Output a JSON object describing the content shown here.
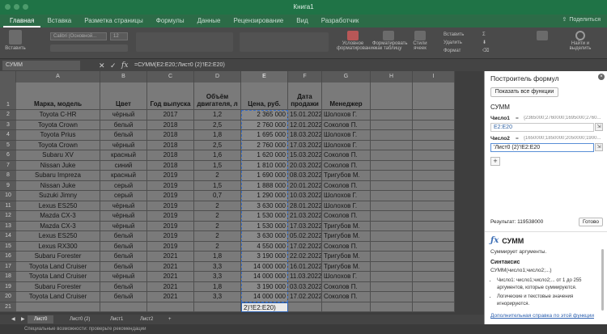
{
  "window": {
    "title": "Книга1"
  },
  "ribbon_tabs": [
    "Главная",
    "Вставка",
    "Разметка страницы",
    "Формулы",
    "Данные",
    "Рецензирование",
    "Вид",
    "Разработчик"
  ],
  "share_label": "Поделиться",
  "ribbon": {
    "paste_label": "Вставить",
    "font_name": "Calibri (Основной...",
    "font_size": "12",
    "cond_format": "Условное форматирование",
    "as_table": "Форматировать как таблицу",
    "cell_styles": "Стили ячеек",
    "insert": "Вставить",
    "delete": "Удалить",
    "format": "Формат",
    "find": "Найти и выделить"
  },
  "formula_bar": {
    "name_box": "СУММ",
    "cancel": "✕",
    "enter": "✓",
    "fx": "fx",
    "formula": "=СУММ(E2:E20;'Лист0 (2)'!E2:E20)"
  },
  "columns": [
    "A",
    "B",
    "C",
    "D",
    "E",
    "F",
    "G",
    "H",
    "I"
  ],
  "headers": {
    "a": "Марка, модель",
    "b": "Цвет",
    "c": "Год выпуска",
    "d": "Объём двигателя, л",
    "e": "Цена, руб.",
    "f": "Дата продажи",
    "g": "Менеджер"
  },
  "rows": [
    [
      "Toyota C-HR",
      "чёрный",
      "2017",
      "1,2",
      "2 365 000",
      "15.01.2022",
      "Шолохов Г."
    ],
    [
      "Toyota Crown",
      "белый",
      "2018",
      "2,5",
      "2 760 000",
      "12.01.2022",
      "Соколов П."
    ],
    [
      "Toyota Prius",
      "белый",
      "2018",
      "1,8",
      "1 695 000",
      "18.03.2022",
      "Шолохов Г."
    ],
    [
      "Toyota Crown",
      "чёрный",
      "2018",
      "2,5",
      "2 760 000",
      "17.03.2022",
      "Шолохов Г."
    ],
    [
      "Subaru XV",
      "красный",
      "2018",
      "1,6",
      "1 620 000",
      "15.03.2022",
      "Соколов П."
    ],
    [
      "Nissan Juke",
      "синий",
      "2018",
      "1,5",
      "1 810 000",
      "20.03.2022",
      "Соколов П."
    ],
    [
      "Subaru Impreza",
      "красный",
      "2019",
      "2",
      "1 690 000",
      "08.03.2022",
      "Тригубов М."
    ],
    [
      "Nissan Juke",
      "серый",
      "2019",
      "1,5",
      "1 888 000",
      "20.01.2022",
      "Соколов П."
    ],
    [
      "Suzuki Jimny",
      "серый",
      "2019",
      "0,7",
      "1 290 000",
      "10.03.2022",
      "Шолохов Г."
    ],
    [
      "Lexus ES250",
      "чёрный",
      "2019",
      "2",
      "3 630 000",
      "28.01.2022",
      "Шолохов Г."
    ],
    [
      "Mazda CX-3",
      "чёрный",
      "2019",
      "2",
      "1 530 000",
      "21.03.2022",
      "Соколов П."
    ],
    [
      "Mazda CX-3",
      "чёрный",
      "2019",
      "2",
      "1 530 000",
      "17.03.2022",
      "Тригубов М."
    ],
    [
      "Lexus ES250",
      "белый",
      "2019",
      "2",
      "3 630 000",
      "05.02.2022",
      "Тригубов М."
    ],
    [
      "Lexus RX300",
      "белый",
      "2019",
      "2",
      "4 550 000",
      "17.02.2022",
      "Соколов П."
    ],
    [
      "Subaru Forester",
      "белый",
      "2021",
      "1,8",
      "3 190 000",
      "22.02.2022",
      "Тригубов М."
    ],
    [
      "Toyota Land Cruiser",
      "белый",
      "2021",
      "3,3",
      "14 000 000",
      "16.01.2022",
      "Тригубов М."
    ],
    [
      "Toyota Land Cruiser",
      "чёрный",
      "2021",
      "3,3",
      "14 000 000",
      "11.03.2022",
      "Шолохов Г."
    ],
    [
      "Subaru Forester",
      "белый",
      "2021",
      "1,8",
      "3 190 000",
      "03.03.2022",
      "Соколов П."
    ],
    [
      "Toyota Land Cruiser",
      "белый",
      "2021",
      "3,3",
      "14 000 000",
      "17.02.2022",
      "Соколов П."
    ]
  ],
  "edit_cell_text": "2)'!E2:E20)",
  "sheet_tabs": [
    "Лист0",
    "Лист0 (2)",
    "Лист1",
    "Лист2"
  ],
  "status_text": "Специальные возможности: проверьте рекомендации",
  "pane": {
    "title": "Построитель формул",
    "show_functions": "Показать все функции",
    "func_name": "СУММ",
    "arg1_label": "Число1",
    "arg1_preview": "{2365000;2760000;1695000;2760...",
    "arg1_value": "E2:E20",
    "arg2_label": "Число2",
    "arg2_preview": "{1650000;1850000;2050000;1900...",
    "arg2_value": "'Лист0 (2)'!E2:E20",
    "eq": "=",
    "plus": "+",
    "result": "Результат: 119538000",
    "done": "Готово",
    "help_title": "СУММ",
    "help_desc": "Суммирует аргументы.",
    "syntax_head": "Синтаксис",
    "syntax": "СУММ(число1;число2;...)",
    "help_items": [
      "Число1: число1;число2;... от 1 до 255 аргументов, которые суммируются.",
      "Логические и текстовые значения игнорируются."
    ],
    "help_link": "Дополнительная справка по этой функции"
  }
}
